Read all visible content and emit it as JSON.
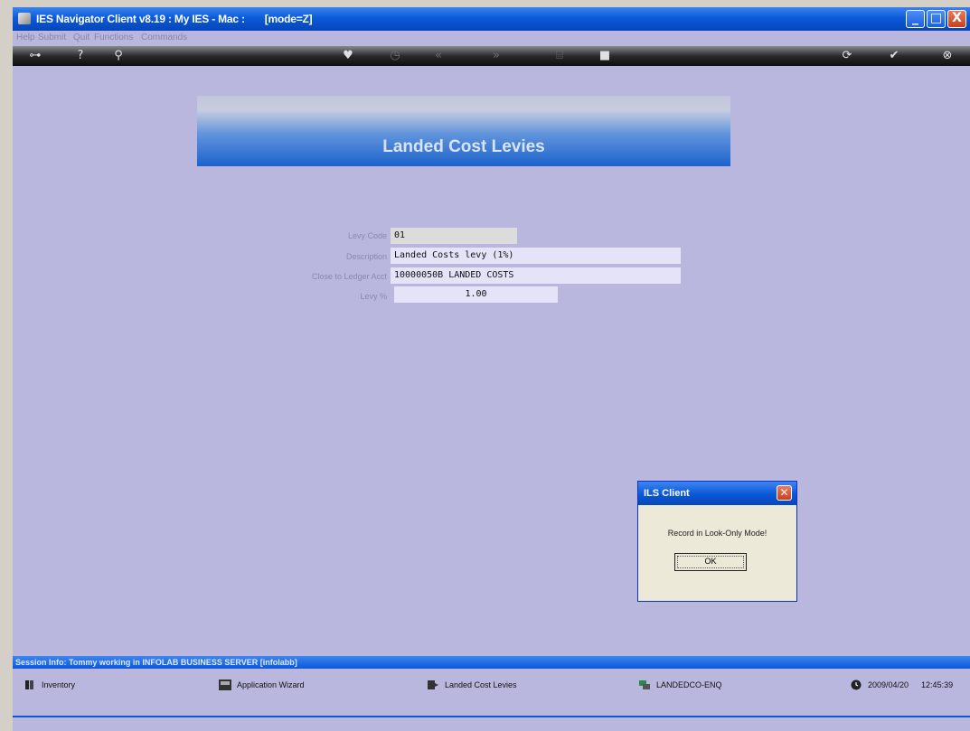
{
  "window": {
    "title": "IES Navigator Client v8.19 : My IES - Mac :       [mode=Z]",
    "buttons": {
      "minimize": "_",
      "maximize": "□",
      "close": "X"
    }
  },
  "menu": [
    "Help",
    "Submit",
    "Quit",
    "Functions",
    "Commands"
  ],
  "toolbar": {
    "icons": [
      "key-icon",
      "help-icon",
      "search-icon",
      "heart-icon",
      "clock-icon",
      "back-icon",
      "forward-icon",
      "tag-icon",
      "stop-icon",
      "refresh-icon",
      "check-icon",
      "close-icon"
    ]
  },
  "header": {
    "title": "Landed Cost Levies"
  },
  "form": {
    "levy_code_label": "Levy Code",
    "levy_code": "01",
    "description_label": "Description",
    "description": "Landed Costs levy (1%)",
    "ledger_label": "Close to Ledger Acct",
    "ledger": "10000050B LANDED COSTS",
    "levy_pct_label": "Levy %",
    "levy_pct": "1.00"
  },
  "dialog": {
    "title": "ILS Client",
    "message": "Record in Look-Only Mode!",
    "ok": "OK"
  },
  "session": {
    "text": "Session Info: Tommy working in INFOLAB BUSINESS SERVER  [infolabb]"
  },
  "status": {
    "inventory": "Inventory",
    "wizard": "Application Wizard",
    "screen": "Landed Cost Levies",
    "code": "LANDEDCO-ENQ",
    "date": "2009/04/20",
    "time": "12:45:39"
  },
  "colors": {
    "background": "#b9b7dd",
    "titlebar": "#0b5bd9",
    "field": "#e4e3f7"
  }
}
